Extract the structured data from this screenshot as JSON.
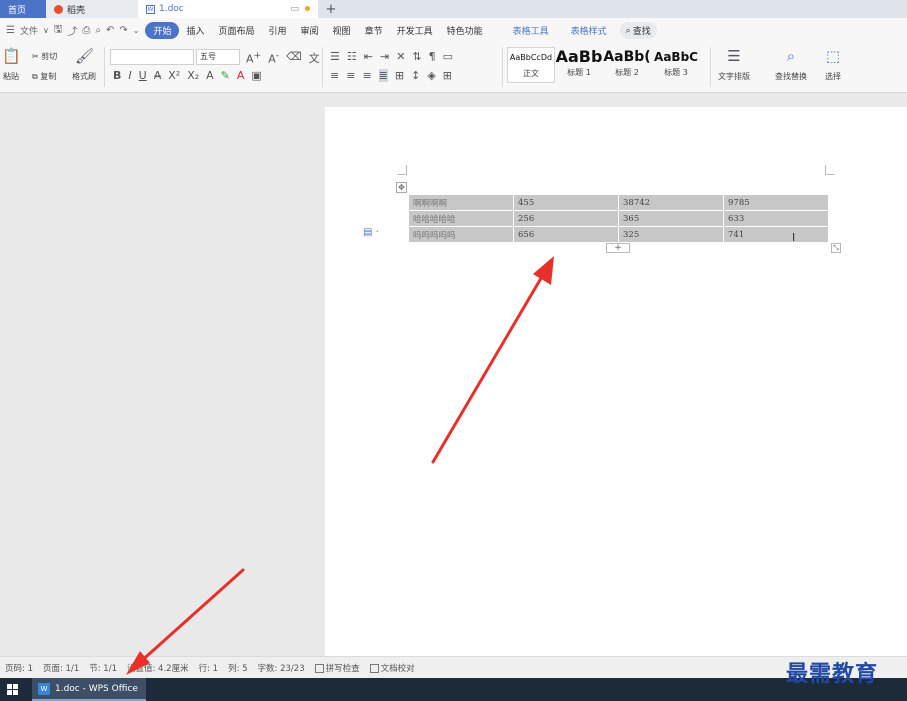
{
  "tabs": {
    "home": "首页",
    "daoke": "稻壳",
    "document": "1.doc",
    "new_tab": "+"
  },
  "menu": {
    "file": "文件",
    "items": [
      "开始",
      "插入",
      "页面布局",
      "引用",
      "审阅",
      "视图",
      "章节",
      "开发工具",
      "特色功能"
    ],
    "context_items": [
      "表格工具",
      "表格样式"
    ],
    "search": "查找"
  },
  "ribbon": {
    "paste": "粘贴",
    "cut": "剪切",
    "copy": "复制",
    "format_painter": "格式刷",
    "font_size": "五号",
    "styles": [
      {
        "sample": "AaBbCcDd",
        "caption": "正文"
      },
      {
        "sample": "AaBb",
        "caption": "标题 1"
      },
      {
        "sample": "AaBb(",
        "caption": "标题 2"
      },
      {
        "sample": "AaBbC",
        "caption": "标题 3"
      }
    ],
    "text_layout": "文字排版",
    "find_replace": "查找替换",
    "select": "选择"
  },
  "table": {
    "rows": [
      [
        "啊啊啊啊",
        "455",
        "38742",
        "9785"
      ],
      [
        "哈哈哈哈哈",
        "256",
        "365",
        "633"
      ],
      [
        "吗吗吗吗吗",
        "656",
        "325",
        "741"
      ]
    ]
  },
  "status": {
    "page_num": "页码: 1",
    "pages": "页面: 1/1",
    "section": "节: 1/1",
    "setting_value": "设置值: 4.2厘米",
    "row": "行: 1",
    "col": "列: 5",
    "word_count": "字数: 23/23",
    "spell_check": "拼写检查",
    "doc_proof": "文档校对"
  },
  "taskbar": {
    "app_label": "1.doc - WPS Office"
  },
  "watermark": "最需教育",
  "colors": {
    "accent": "#4b74c9",
    "arrow": "#e8302a",
    "table_fill": "#c7c7c7",
    "watermark": "#2249a6"
  }
}
